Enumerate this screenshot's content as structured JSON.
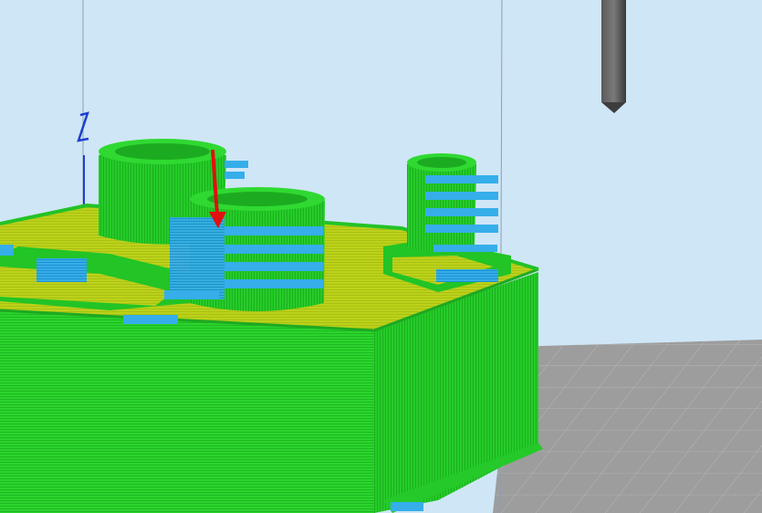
{
  "viewport": {
    "kind": "3d-gcode-layer-preview",
    "background_color": "#cfe6f7"
  },
  "colors": {
    "perimeter_green": "#27d12a",
    "infill_yellow": "#bfd31a",
    "support_blue": "#2ea6e6",
    "travel_line": "#6f8aa0",
    "travel_arrow_red": "#e01010",
    "build_plate_grey": "#9a9a9a",
    "nozzle_grey": "#4a4a4a",
    "z_indicator_blue": "#1d3fd0"
  },
  "objects": [
    {
      "name": "printed-part-base",
      "role": "model"
    },
    {
      "name": "cylinder-left",
      "role": "model"
    },
    {
      "name": "cylinder-center",
      "role": "model"
    },
    {
      "name": "cylinder-right",
      "role": "model"
    },
    {
      "name": "support-structures",
      "role": "support"
    },
    {
      "name": "nozzle",
      "role": "tool"
    },
    {
      "name": "build-plate",
      "role": "bed"
    }
  ]
}
